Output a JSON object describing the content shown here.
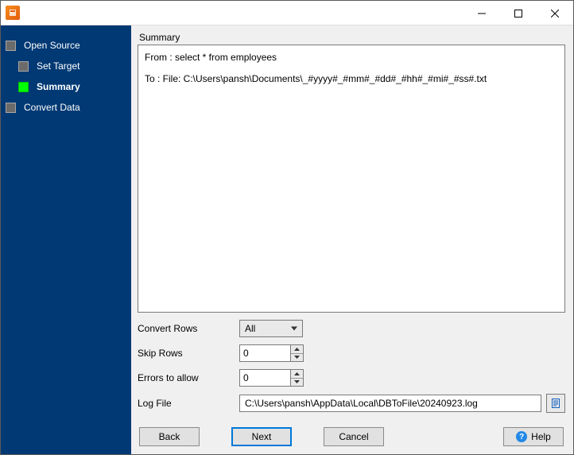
{
  "window": {
    "title": ""
  },
  "sidebar": {
    "items": [
      {
        "label": "Open Source",
        "active": false,
        "current": false
      },
      {
        "label": "Set Target",
        "active": false,
        "current": false
      },
      {
        "label": "Summary",
        "active": true,
        "current": true
      },
      {
        "label": "Convert Data",
        "active": false,
        "current": false
      }
    ]
  },
  "main": {
    "section_title": "Summary",
    "summary_from": "From : select * from employees",
    "summary_to": "To : File: C:\\Users\\pansh\\Documents\\_#yyyy#_#mm#_#dd#_#hh#_#mi#_#ss#.txt",
    "convert_rows_label": "Convert Rows",
    "convert_rows_value": "All",
    "skip_rows_label": "Skip Rows",
    "skip_rows_value": "0",
    "errors_label": "Errors to allow",
    "errors_value": "0",
    "logfile_label": "Log File",
    "logfile_value": "C:\\Users\\pansh\\AppData\\Local\\DBToFile\\20240923.log"
  },
  "buttons": {
    "back": "Back",
    "next": "Next",
    "cancel": "Cancel",
    "help": "Help"
  }
}
